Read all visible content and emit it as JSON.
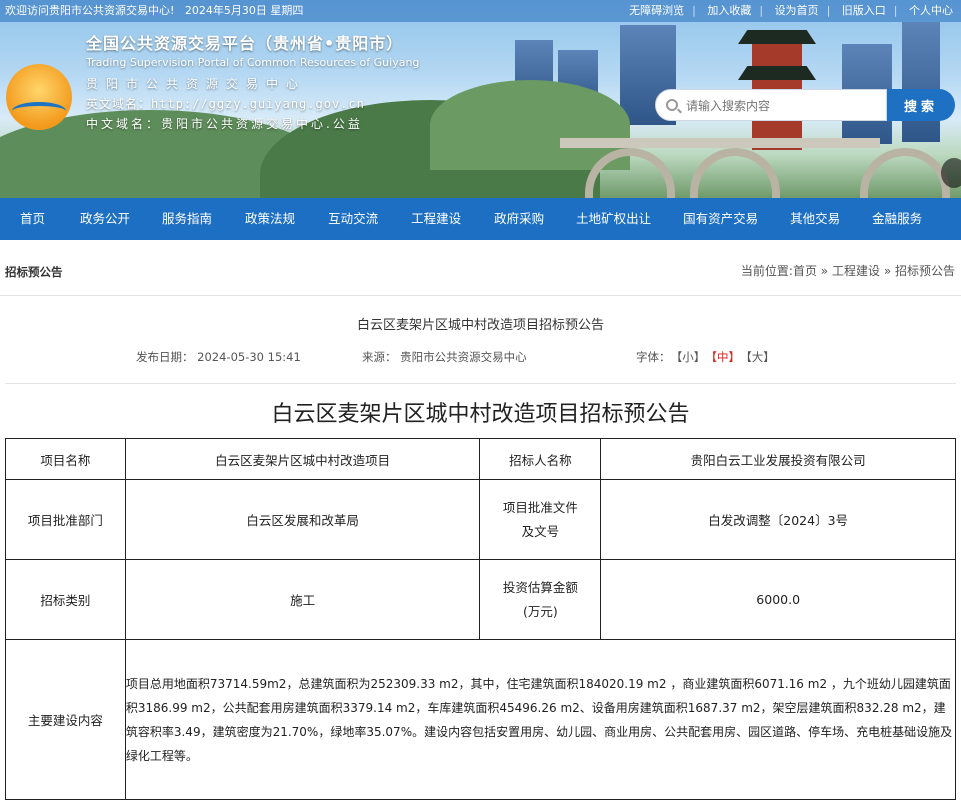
{
  "topbar": {
    "welcome": "欢迎访问贵阳市公共资源交易中心!",
    "date": "2024年5月30日 星期四",
    "links": [
      "无障碍浏览",
      "加入收藏",
      "设为首页",
      "旧版入口",
      "个人中心"
    ]
  },
  "brand": {
    "title": "全国公共资源交易平台（贵州省•贵阳市）",
    "en": "Trading Supervision Portal of Common Resources of Guiyang",
    "cn_name": "贵阳市公共资源交易中心",
    "en_domain_label": "英文域名：",
    "en_domain": "http://ggzy.guiyang.gov.cn",
    "cn_domain_label": "中文域名：",
    "cn_domain": "贵阳市公共资源交易中心.公益"
  },
  "search": {
    "placeholder": "请输入搜索内容",
    "button": "搜索"
  },
  "nav": [
    "首页",
    "政务公开",
    "服务指南",
    "政策法规",
    "互动交流",
    "工程建设",
    "政府采购",
    "土地矿权出让",
    "国有资产交易",
    "其他交易",
    "金融服务"
  ],
  "breadcrumb": {
    "section": "招标预公告",
    "prefix": "当前位置:",
    "items": [
      "首页",
      "工程建设",
      "招标预公告"
    ],
    "sep": "»"
  },
  "article": {
    "title": "白云区麦架片区城中村改造项目招标预公告",
    "publish_label": "发布日期：",
    "publish_date": "2024-05-30 15:41",
    "source_label": "来源：",
    "source": "贵阳市公共资源交易中心",
    "font_label": "字体：",
    "font_small": "【小】",
    "font_medium": "【中】",
    "font_large": "【大】"
  },
  "table": {
    "r1": {
      "k1": "项目名称",
      "v1": "白云区麦架片区城中村改造项目",
      "k2": "招标人名称",
      "v2": "贵阳白云工业发展投资有限公司"
    },
    "r2": {
      "k1": "项目批准部门",
      "v1": "白云区发展和改革局",
      "k2": "项目批准文件及文号",
      "v2": "白发改调整〔2024〕3号"
    },
    "r3": {
      "k1": "招标类别",
      "v1": "施工",
      "k2": "投资估算金额(万元)",
      "v2": "6000.0"
    },
    "r4": {
      "k1": "主要建设内容",
      "v1": "项目总用地面积73714.59m2，总建筑面积为252309.33 m2，其中，住宅建筑面积184020.19 m2 ，商业建筑面积6071.16 m2 ，九个班幼儿园建筑面积3186.99 m2，公共配套用房建筑面积3379.14 m2，车库建筑面积45496.26 m2、设备用房建筑面积1687.37 m2，架空层建筑面积832.28 m2，建筑容积率3.49，建筑密度为21.70%，绿地率35.07%。建设内容包括安置用房、幼儿园、商业用房、公共配套用房、园区道路、停车场、充电桩基础设施及绿化工程等。"
    }
  },
  "colors": {
    "nav": "#1d6fc4",
    "accent_red": "#d6271c",
    "search_button": "#1e70c3"
  }
}
